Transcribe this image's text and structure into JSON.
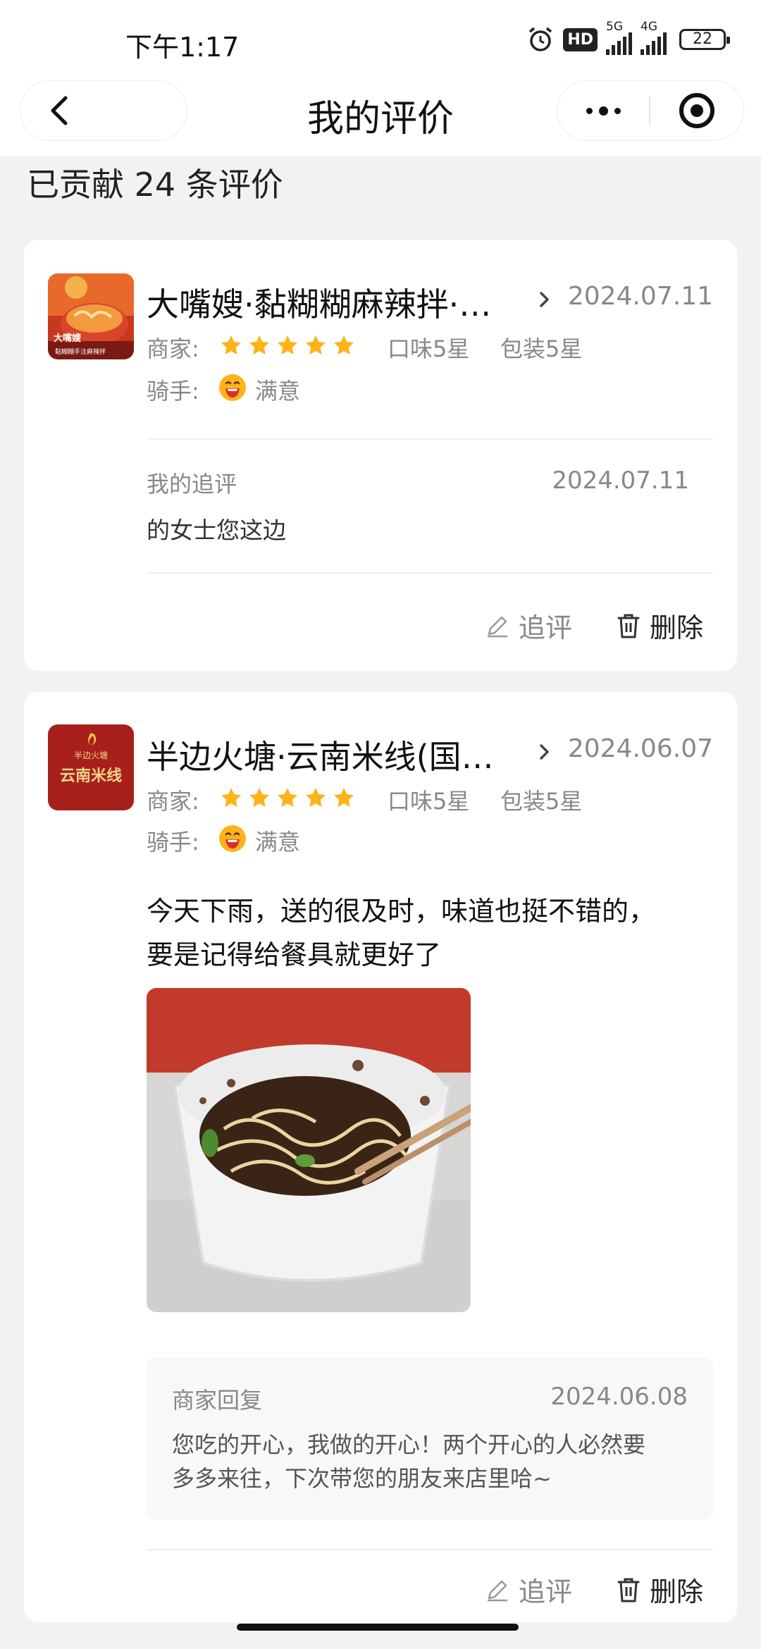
{
  "status_bar": {
    "time": "下午1:17",
    "hd_label": "HD",
    "net1_label": "5G",
    "net2_label": "4G",
    "battery": "22"
  },
  "nav": {
    "title": "我的评价"
  },
  "summary": {
    "count_text": "已贡献 24 条评价"
  },
  "labels": {
    "merchant": "商家:",
    "rider": "骑手:",
    "follow_up": "追评",
    "delete": "删除",
    "my_follow_up": "我的追评",
    "merchant_reply": "商家回复"
  },
  "reviews": [
    {
      "shop_name": "大嘴嫂·黏糊糊麻辣拌·…",
      "date": "2024.07.11",
      "merchant_stars": 5,
      "taste": "口味5星",
      "packaging": "包装5星",
      "rider_rating": "满意",
      "follow_up": {
        "date": "2024.07.11",
        "text": "的女士您这边"
      },
      "thumb_text_top": "大嘴嫂",
      "thumb_text_bottom": "黏糊糊手注麻辣拌"
    },
    {
      "shop_name": "半边火塘·云南米线(国…",
      "date": "2024.06.07",
      "merchant_stars": 5,
      "taste": "口味5星",
      "packaging": "包装5星",
      "rider_rating": "满意",
      "text_line1": "今天下雨，送的很及时，味道也挺不错的，",
      "text_line2": "要是记得给餐具就更好了",
      "reply": {
        "date": "2024.06.08",
        "text_line1": "您吃的开心，我做的开心！两个开心的人必然要",
        "text_line2": "多多来往，下次带您的朋友来店里哈~"
      },
      "thumb_text_top": "半边火塘",
      "thumb_text_bottom": "云南米线"
    }
  ],
  "colors": {
    "star": "#FFB21A",
    "background": "#F2F2F2",
    "card": "#FFFFFF",
    "muted_text": "#888888"
  }
}
